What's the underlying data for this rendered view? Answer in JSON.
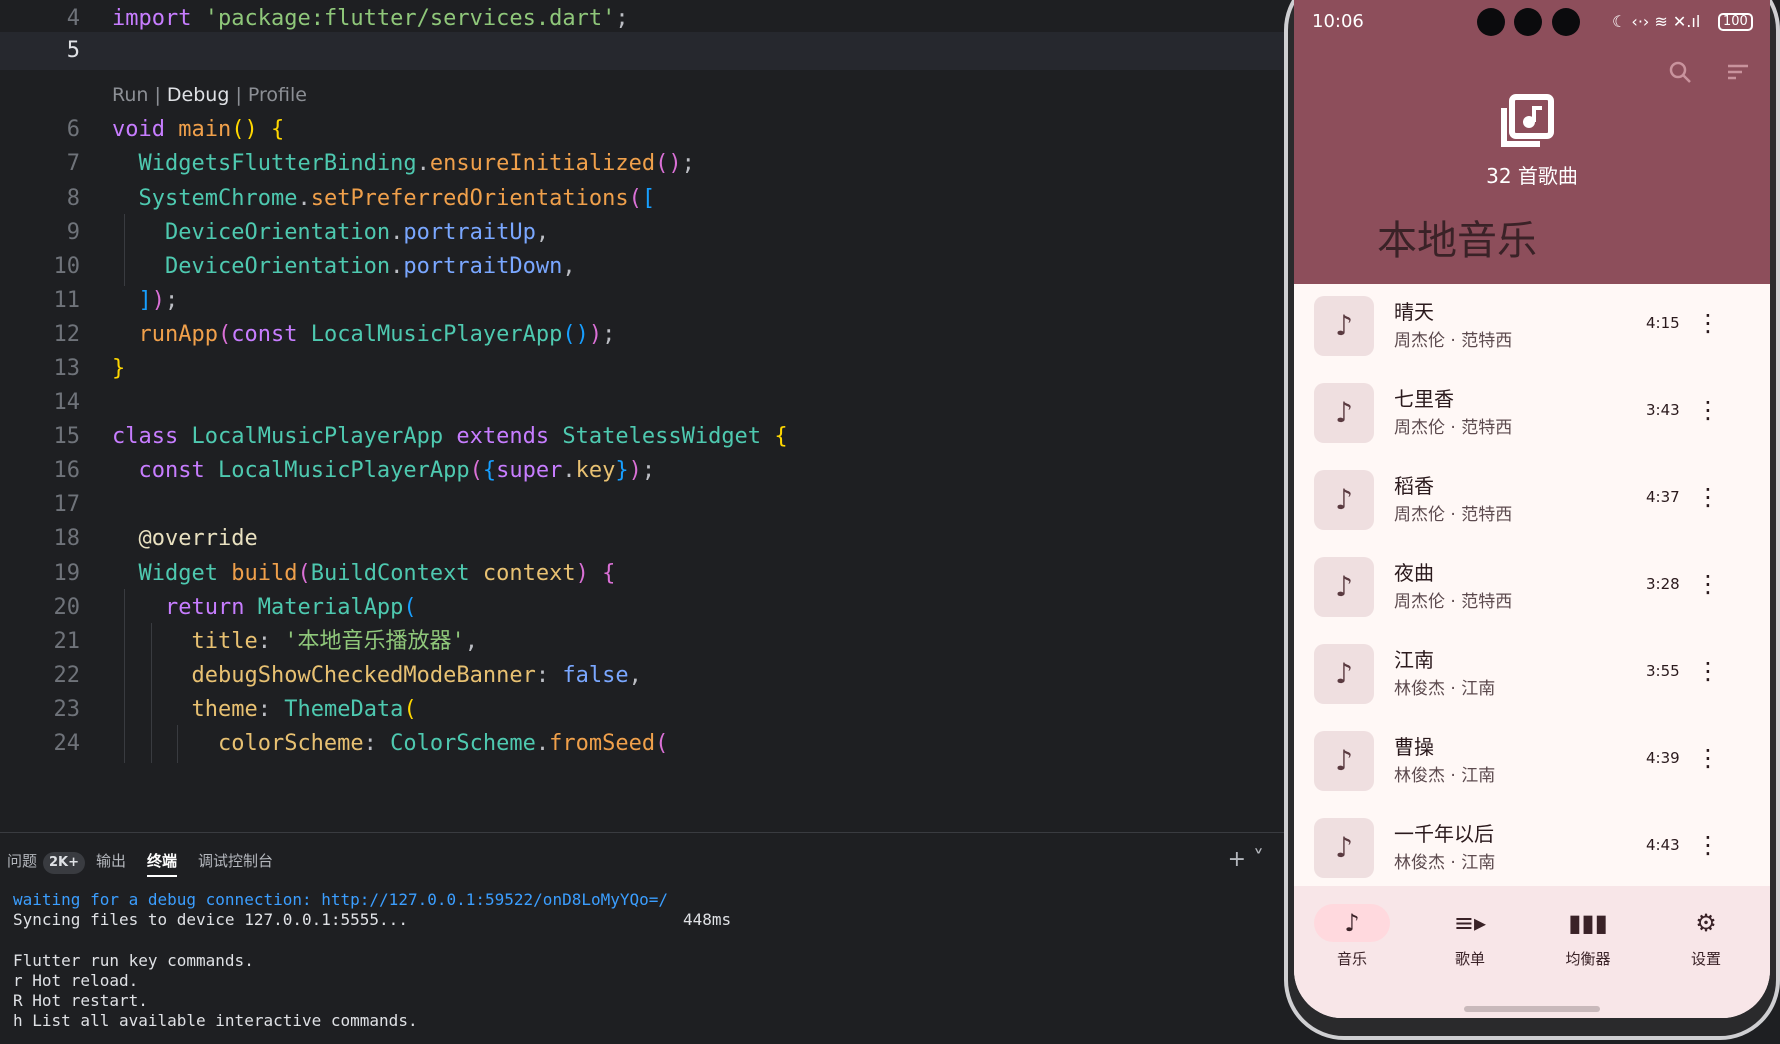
{
  "editor": {
    "codelens": {
      "run": "Run",
      "sep": " | ",
      "debug": "Debug",
      "profile": "Profile"
    },
    "lines": [
      {
        "num": "4",
        "html": "<span class='t-kw'>import</span> <span class='t-str'>'package:flutter/services.dart'</span><span class='t-punc'>;</span>"
      },
      {
        "num": "5",
        "html": ""
      },
      {
        "num": "6",
        "html": "<span class='t-kw'>void</span> <span class='t-fn'>main</span><span class='t-b1'>()</span> <span class='t-b1'>{</span>"
      },
      {
        "num": "7",
        "html": "  <span class='t-type'>WidgetsFlutterBinding</span>.<span class='t-fn'>ensureInitialized</span><span class='t-b2'>()</span>;"
      },
      {
        "num": "8",
        "html": "  <span class='t-type'>SystemChrome</span>.<span class='t-fn'>setPreferredOrientations</span><span class='t-b2'>(</span><span class='t-b3'>[</span>"
      },
      {
        "num": "9",
        "html": "    <span class='t-type'>DeviceOrientation</span>.<span class='t-prop'>portraitUp</span>,"
      },
      {
        "num": "10",
        "html": "    <span class='t-type'>DeviceOrientation</span>.<span class='t-prop'>portraitDown</span>,"
      },
      {
        "num": "11",
        "html": "  <span class='t-b3'>]</span><span class='t-b2'>)</span>;"
      },
      {
        "num": "12",
        "html": "  <span class='t-fn'>runApp</span><span class='t-b2'>(</span><span class='t-kw'>const</span> <span class='t-type'>LocalMusicPlayerApp</span><span class='t-b3'>()</span><span class='t-b2'>)</span>;"
      },
      {
        "num": "13",
        "html": "<span class='t-b1'>}</span>"
      },
      {
        "num": "14",
        "html": ""
      },
      {
        "num": "15",
        "html": "<span class='t-kw'>class</span> <span class='t-type'>LocalMusicPlayerApp</span> <span class='t-kw'>extends</span> <span class='t-type'>StatelessWidget</span> <span class='t-b1'>{</span>"
      },
      {
        "num": "16",
        "html": "  <span class='t-kw'>const</span> <span class='t-type'>LocalMusicPlayerApp</span><span class='t-b2'>(</span><span class='t-b3'>{</span><span class='t-kw'>super</span>.<span class='t-field'>key</span><span class='t-b3'>}</span><span class='t-b2'>)</span>;"
      },
      {
        "num": "17",
        "html": ""
      },
      {
        "num": "18",
        "html": "  <span class='t-meta'>@override</span>"
      },
      {
        "num": "19",
        "html": "  <span class='t-type'>Widget</span> <span class='t-fn'>build</span><span class='t-b2'>(</span><span class='t-type'>BuildContext</span> <span class='t-field'>context</span><span class='t-b2'>)</span> <span class='t-b2'>{</span>"
      },
      {
        "num": "20",
        "html": "    <span class='t-kw'>return</span> <span class='t-type'>MaterialApp</span><span class='t-b3'>(</span>"
      },
      {
        "num": "21",
        "html": "      <span class='t-field'>title</span>: <span class='t-str'>'本地音乐播放器'</span>,"
      },
      {
        "num": "22",
        "html": "      <span class='t-field'>debugShowCheckedModeBanner</span>: <span class='t-bool'>false</span>,"
      },
      {
        "num": "23",
        "html": "      <span class='t-field'>theme</span>: <span class='t-type'>ThemeData</span><span class='t-b1'>(</span>"
      },
      {
        "num": "24",
        "html": "        <span class='t-field'>colorScheme</span>: <span class='t-type'>ColorScheme</span>.<span class='t-fn'>fromSeed</span><span class='t-b2'>(</span>"
      }
    ]
  },
  "panel": {
    "tabs": [
      {
        "label": "问题",
        "badge": "2K+"
      },
      {
        "label": "输出"
      },
      {
        "label": "终端"
      },
      {
        "label": "调试控制台"
      }
    ],
    "actions": "+ ˅",
    "terminal": [
      "waiting for a debug connection: http://127.0.0.1:59522/onD8LoMyYQo=/",
      "Syncing files to device 127.0.0.1:5555...",
      "",
      "Flutter run key commands.",
      "r Hot reload.",
      "R Hot restart.",
      "h List all available interactive commands."
    ],
    "sync_time": "448ms"
  },
  "phone": {
    "time": "10:06",
    "status_icons": "☾ ‹·› ≋ ✕.ıl",
    "battery": "100",
    "song_count": "32 首歌曲",
    "title": "本地音乐",
    "songs": [
      {
        "title": "晴天",
        "sub": "周杰伦 · 范特西",
        "dur": "4:15"
      },
      {
        "title": "七里香",
        "sub": "周杰伦 · 范特西",
        "dur": "3:43"
      },
      {
        "title": "稻香",
        "sub": "周杰伦 · 范特西",
        "dur": "4:37"
      },
      {
        "title": "夜曲",
        "sub": "周杰伦 · 范特西",
        "dur": "3:28"
      },
      {
        "title": "江南",
        "sub": "林俊杰 · 江南",
        "dur": "3:55"
      },
      {
        "title": "曹操",
        "sub": "林俊杰 · 江南",
        "dur": "4:39"
      },
      {
        "title": "一千年以后",
        "sub": "林俊杰 · 江南",
        "dur": "4:43"
      }
    ],
    "nav": [
      {
        "label": "音乐",
        "icon": "♪",
        "active": true
      },
      {
        "label": "歌单",
        "icon": "≡▸"
      },
      {
        "label": "均衡器",
        "icon": "▮▮▮"
      },
      {
        "label": "设置",
        "icon": "⚙"
      }
    ],
    "colors": {
      "header": "#8d4e5b",
      "nav_bg": "#f8e6e8",
      "active_pill": "#ffd9de",
      "list_bg": "#fff8f6"
    }
  }
}
